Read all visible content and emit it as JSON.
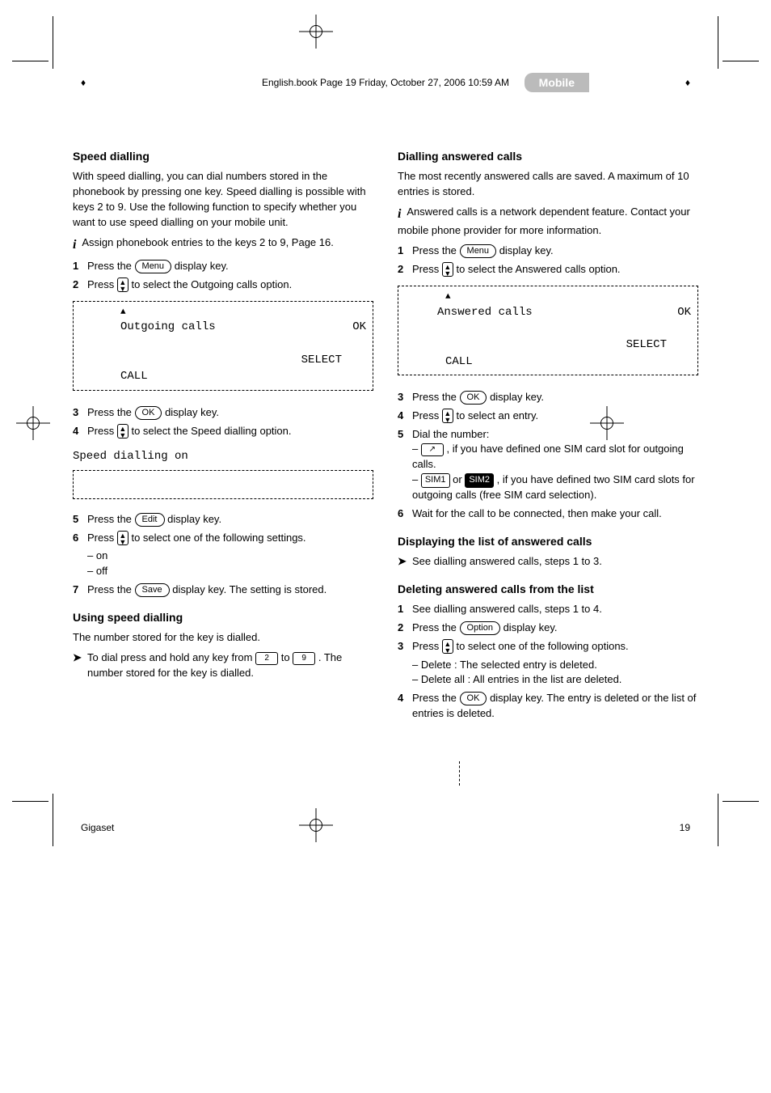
{
  "header": {
    "file": "English.book  Page 19  Friday, October 27, 2006  10:59 AM"
  },
  "section_tab": "Mobile",
  "left": {
    "heading_speed": "Speed dialling",
    "p_speed": "With speed dialling, you can dial numbers stored in the phonebook by pressing one key. Speed dialling is possible with keys 2 to 9. Use the following function to specify whether you want to use speed dialling on your mobile unit.",
    "i_note": "Assign phonebook entries to the keys 2 to 9, Page 16.",
    "step1_a": "Press the ",
    "step1_key": "Menu",
    "step1_b": " display key.",
    "step2_a": "Press ",
    "step2_b": " to select the  Outgoing calls  option.",
    "lcd1": {
      "title": "Outgoing calls",
      "ok": "OK",
      "select": "SELECT",
      "call": "CALL"
    },
    "step3_a": "Press the ",
    "step3_key": "OK",
    "step3_b": " display key.",
    "step4_a": "Press ",
    "step4_b": " to select the  Speed dialling  option.",
    "mono": "Speed dialling on",
    "step5_a": "Press the ",
    "step5_key": "Edit",
    "step5_b": " display key.",
    "step6_a": "Press ",
    "step6_b": " to select one of the following settings.",
    "opt1": "– on",
    "opt2": "– off",
    "step7_a": "Press the ",
    "step7_key": "Save",
    "step7_b": " display key. The setting is stored.",
    "heading_use": "Using speed dialling",
    "p_use1": "The number stored for the key is dialled.",
    "p_use2a": "To dial press and hold any key from ",
    "p_use2b": " to ",
    "p_use2c": ". The number stored for the key is dialled."
  },
  "right": {
    "heading": "Dialling answered calls",
    "p1": "The most recently answered calls are saved. A maximum of 10 entries is stored.",
    "i_note": "Answered calls is a network dependent feature. Contact your mobile phone provider for more information.",
    "step1_a": "Press the ",
    "step1_key": "Menu",
    "step1_b": " display key.",
    "step2_a": "Press ",
    "step2_b": " to select the  Answered calls  option.",
    "lcd": {
      "title": "Answered calls",
      "ok": "OK",
      "select": "SELECT",
      "call": "CALL"
    },
    "step3_a": "Press the ",
    "step3_key": "OK",
    "step3_b": " display key.",
    "step4_a": "Press ",
    "step4_b": " to select an entry.",
    "step5": "Dial the number:",
    "step5_a": "– ",
    "step5_b": ", if you have defined one SIM card slot for outgoing calls.",
    "step5_c": "– ",
    "step5_d": " or ",
    "step5_e": ", if you have defined two SIM card slots for outgoing calls (free SIM card selection).",
    "step6": "Wait for the call to be connected, then make your call.",
    "heading2": "Displaying the list of answered calls",
    "p2": "See dialling answered calls, steps 1 to 3.",
    "heading3": "Deleting answered calls from the list",
    "step_d1": "See dialling answered calls, steps 1 to 4.",
    "step_d2_a": "Press the ",
    "step_d2_key": "Option",
    "step_d2_b": " display key.",
    "step_d3_a": "Press ",
    "step_d3_b": " to select one of the following options.",
    "opt1": "– Delete : The selected entry is deleted.",
    "opt2": "– Delete all : All entries in the list are deleted.",
    "step_d4_a": "Press the ",
    "step_d4_key": "OK",
    "step_d4_b": " display key. The entry is deleted or the list of entries is deleted."
  },
  "footer": {
    "brand": "Gigaset",
    "page": "19"
  }
}
